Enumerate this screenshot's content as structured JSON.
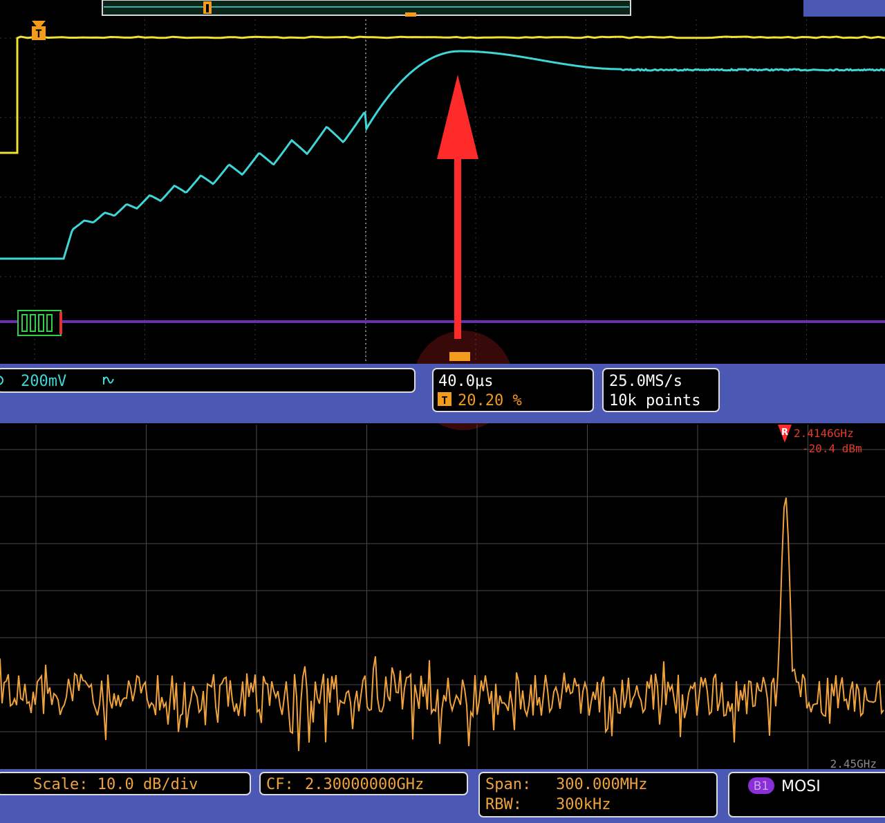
{
  "channel": {
    "scale": "200mV",
    "coupling_icon": "bandwidth-limit-icon"
  },
  "horizontal": {
    "time_per_div": "40.0µs",
    "trigger_position": "20.20 %"
  },
  "acquisition": {
    "sample_rate": "25.0MS/s",
    "record_length": "10k points"
  },
  "spectrum": {
    "reference_marker": {
      "letter": "R",
      "frequency": "2.4146GHz",
      "level": "-20.4 dBm"
    },
    "stop_frequency": "2.45GHz",
    "scale": "Scale: 10.0 dB/div",
    "center_frequency_label": "CF:",
    "center_frequency_value": "2.30000000GHz",
    "span_label": "Span:",
    "span_value": "300.000MHz",
    "rbw_label": "RBW:",
    "rbw_value": "300kHz"
  },
  "bus": {
    "badge": "B1",
    "name": "MOSI"
  },
  "trigger_marker_letter": "T",
  "colors": {
    "ch1_yellow": "#f0e22e",
    "ch2_cyan": "#3fd6d8",
    "bus_purple": "#6a2fb8",
    "spectrum_orange": "#f0a23c",
    "trigger_orange": "#f29b1c",
    "status_bar_blue": "#4b59b4",
    "annotation_red": "#ff2a2a"
  }
}
